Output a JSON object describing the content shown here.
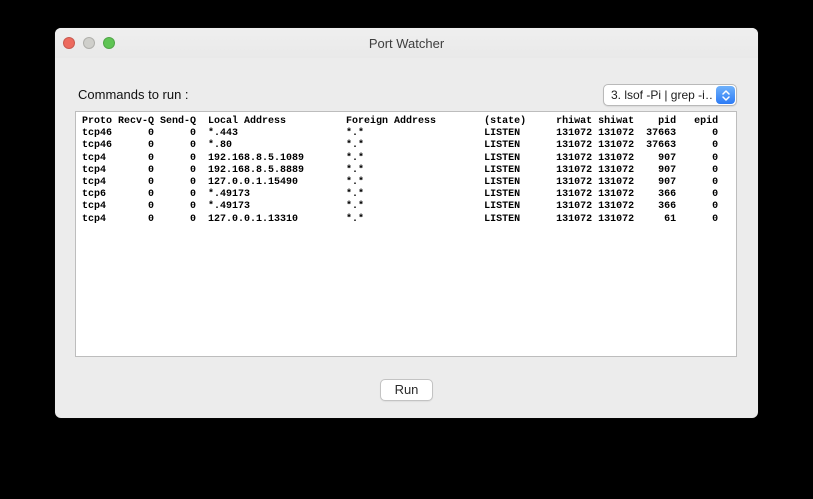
{
  "window": {
    "title": "Port Watcher",
    "traffic_lights": {
      "close_color": "#ed6a5e",
      "minimize_color": "#cfcfcb",
      "zoom_color": "#5fc454"
    }
  },
  "commands_label": "Commands to run :",
  "command_select": {
    "selected": "3. lsof -Pi | grep -i…",
    "stepper_color": "#3d87f7"
  },
  "output": {
    "columns": [
      {
        "header": "Proto",
        "start": 0,
        "width": 5,
        "align": "left"
      },
      {
        "header": "Recv-Q",
        "start": 6,
        "width": 6,
        "align": "right"
      },
      {
        "header": "Send-Q",
        "start": 13,
        "width": 6,
        "align": "right"
      },
      {
        "header": "Local Address",
        "start": 21,
        "width": 22,
        "align": "left"
      },
      {
        "header": "Foreign Address",
        "start": 44,
        "width": 22,
        "align": "left"
      },
      {
        "header": "(state)",
        "start": 67,
        "width": 11,
        "align": "left"
      },
      {
        "header": "rhiwat",
        "start": 79,
        "width": 6,
        "align": "right"
      },
      {
        "header": "shiwat",
        "start": 86,
        "width": 6,
        "align": "right"
      },
      {
        "header": "pid",
        "start": 93,
        "width": 6,
        "align": "right"
      },
      {
        "header": "epid",
        "start": 100,
        "width": 6,
        "align": "right"
      }
    ],
    "rows": [
      [
        "tcp46",
        "0",
        "0",
        "*.443",
        "*.*",
        "LISTEN",
        "131072",
        "131072",
        "37663",
        "0"
      ],
      [
        "tcp46",
        "0",
        "0",
        "*.80",
        "*.*",
        "LISTEN",
        "131072",
        "131072",
        "37663",
        "0"
      ],
      [
        "tcp4",
        "0",
        "0",
        "192.168.8.5.1089",
        "*.*",
        "LISTEN",
        "131072",
        "131072",
        "907",
        "0"
      ],
      [
        "tcp4",
        "0",
        "0",
        "192.168.8.5.8889",
        "*.*",
        "LISTEN",
        "131072",
        "131072",
        "907",
        "0"
      ],
      [
        "tcp4",
        "0",
        "0",
        "127.0.0.1.15490",
        "*.*",
        "LISTEN",
        "131072",
        "131072",
        "907",
        "0"
      ],
      [
        "tcp6",
        "0",
        "0",
        "*.49173",
        "*.*",
        "LISTEN",
        "131072",
        "131072",
        "366",
        "0"
      ],
      [
        "tcp4",
        "0",
        "0",
        "*.49173",
        "*.*",
        "LISTEN",
        "131072",
        "131072",
        "366",
        "0"
      ],
      [
        "tcp4",
        "0",
        "0",
        "127.0.0.1.13310",
        "*.*",
        "LISTEN",
        "131072",
        "131072",
        "61",
        "0"
      ]
    ]
  },
  "run_button": {
    "label": "Run"
  }
}
